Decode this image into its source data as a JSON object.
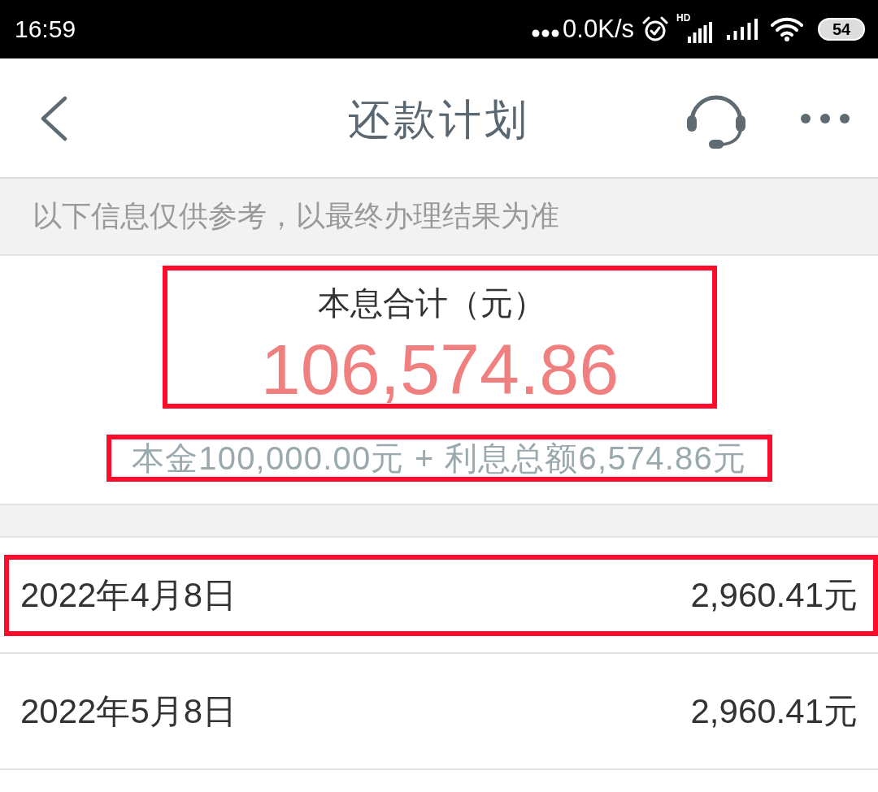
{
  "status_bar": {
    "time": "16:59",
    "net_speed": "0.0K/s",
    "network_type": "HD",
    "battery": "54"
  },
  "header": {
    "title": "还款计划"
  },
  "notice": "以下信息仅供参考，以最终办理结果为准",
  "summary": {
    "label": "本息合计（元）",
    "total": "106,574.86",
    "highlighted": true,
    "breakdown": "本金100,000.00元 + 利息总额6,574.86元",
    "breakdown_highlighted": true
  },
  "schedule": [
    {
      "date": "2022年4月8日",
      "amount": "2,960.41元",
      "highlighted": true
    },
    {
      "date": "2022年5月8日",
      "amount": "2,960.41元",
      "highlighted": false
    }
  ]
}
